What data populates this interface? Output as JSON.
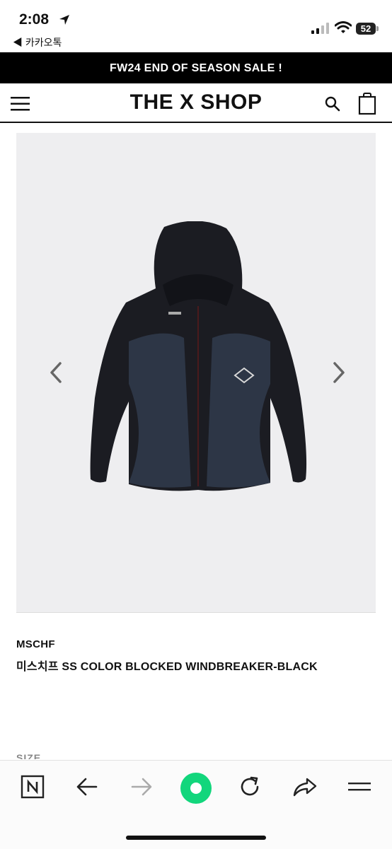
{
  "status_bar": {
    "time": "2:08",
    "back_app": "◀ 카카오톡",
    "battery": "52"
  },
  "promo": {
    "text": "FW24 END OF SEASON SALE !"
  },
  "header": {
    "logo": "THE X SHOP"
  },
  "product": {
    "brand": "MSCHF",
    "name": "미스치프 SS COLOR BLOCKED WINDBREAKER-BLACK",
    "size_label": "SIZE"
  },
  "colors": {
    "banner_bg": "#000000",
    "image_bg": "#eeeef0",
    "accent": "#12d67c"
  },
  "icons": [
    "location-arrow-icon",
    "signal-icon",
    "wifi-icon",
    "battery-icon",
    "menu-icon",
    "search-icon",
    "bag-icon",
    "chevron-left-icon",
    "chevron-right-icon",
    "naver-icon",
    "back-arrow-icon",
    "forward-arrow-icon",
    "green-dot-icon",
    "refresh-icon",
    "share-icon",
    "hamburger-icon"
  ]
}
